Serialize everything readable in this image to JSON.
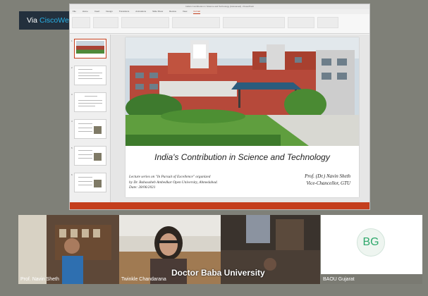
{
  "webex": {
    "prefix": "Via",
    "brand": "CiscoWebex"
  },
  "ppt": {
    "window_title": "India's Contribution in Science and Technology [Autosaved] - PowerPoint",
    "tabs": [
      "File",
      "Home",
      "Insert",
      "Design",
      "Transitions",
      "Animations",
      "Slide Show",
      "Review",
      "View",
      "Format"
    ],
    "slide_numbers": [
      "1",
      "2",
      "3",
      "4",
      "5",
      "6"
    ]
  },
  "slide": {
    "title": "India's Contribution in Science and Technology",
    "meta_lines": [
      "Lecture series on \"In Pursuit of Excellence\" organized",
      "by Dr. Babasaheb Ambedkar Open University, Ahmedabad.",
      "Date: 28/06/2021"
    ],
    "author_name": "Prof. (Dr.) Navin Sheth",
    "author_title": "Vice-Chancellor, GTU"
  },
  "participants": [
    {
      "name": "Prof. Navin Sheth"
    },
    {
      "name": "Twinkle Chandarana"
    },
    {
      "name": ""
    },
    {
      "name": "BAOU Gujarat",
      "initials": "BG"
    }
  ],
  "overlay_caption": "Doctor Baba University",
  "colors": {
    "ppt_accent": "#c43e1c",
    "webex_blue": "#28b0e6",
    "avatar_green": "#2ea86b"
  }
}
